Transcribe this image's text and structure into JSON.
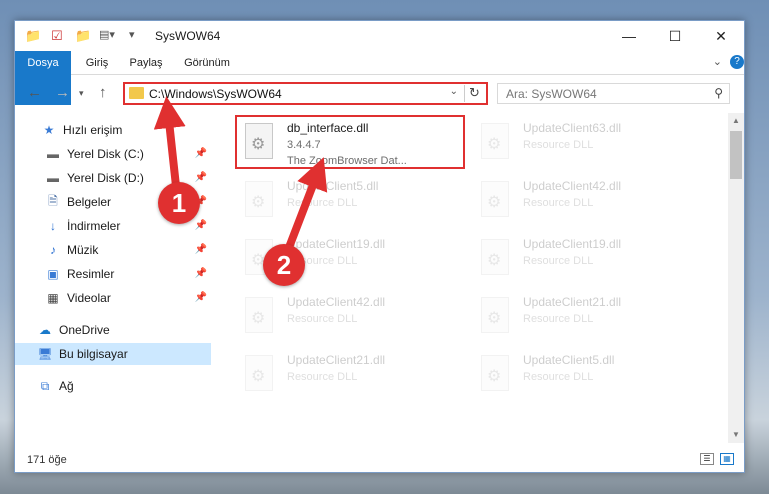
{
  "window": {
    "title": "SysWOW64",
    "controls": {
      "minimize": "—",
      "maximize": "☐",
      "close": "✕"
    }
  },
  "ribbon": {
    "tabs": [
      "Dosya",
      "Giriş",
      "Paylaş",
      "Görünüm"
    ]
  },
  "nav": {
    "address": "C:\\Windows\\SysWOW64",
    "search_placeholder": "Ara: SysWOW64"
  },
  "sidebar": {
    "items": [
      {
        "label": "Hızlı erişim",
        "icon": "star-icon"
      },
      {
        "label": "Yerel Disk (C:)",
        "icon": "drive-icon"
      },
      {
        "label": "Yerel Disk (D:)",
        "icon": "drive-icon"
      },
      {
        "label": "Belgeler",
        "icon": "documents-icon"
      },
      {
        "label": "İndirmeler",
        "icon": "download-icon"
      },
      {
        "label": "Müzik",
        "icon": "music-icon"
      },
      {
        "label": "Resimler",
        "icon": "pictures-icon"
      },
      {
        "label": "Videolar",
        "icon": "videos-icon"
      },
      {
        "label": "OneDrive",
        "icon": "cloud-icon"
      },
      {
        "label": "Bu bilgisayar",
        "icon": "computer-icon"
      },
      {
        "label": "Ağ",
        "icon": "network-icon"
      }
    ]
  },
  "files": [
    {
      "name": "db_interface.dll",
      "line1": "3.4.4.7",
      "line2": "The ZoomBrowser Dat..."
    },
    {
      "name": "UpdateClient63.dll",
      "line1": "Resource DLL"
    },
    {
      "name": "UpdateClient5.dll",
      "line1": "Resource DLL"
    },
    {
      "name": "UpdateClient42.dll",
      "line1": "Resource DLL"
    },
    {
      "name": "UpdateClient19.dll",
      "line1": "Resource DLL"
    },
    {
      "name": "UpdateClient19.dll",
      "line1": "Resource DLL"
    },
    {
      "name": "UpdateClient42.dll",
      "line1": "Resource DLL"
    },
    {
      "name": "UpdateClient21.dll",
      "line1": "Resource DLL"
    },
    {
      "name": "UpdateClient21.dll",
      "line1": "Resource DLL"
    },
    {
      "name": "UpdateClient5.dll",
      "line1": "Resource DLL"
    }
  ],
  "status": {
    "count": "171 öğe"
  },
  "annotations": {
    "step1": "1",
    "step2": "2"
  },
  "colors": {
    "accent": "#1979ca",
    "highlight": "#e03030",
    "selected": "#cce8ff"
  }
}
